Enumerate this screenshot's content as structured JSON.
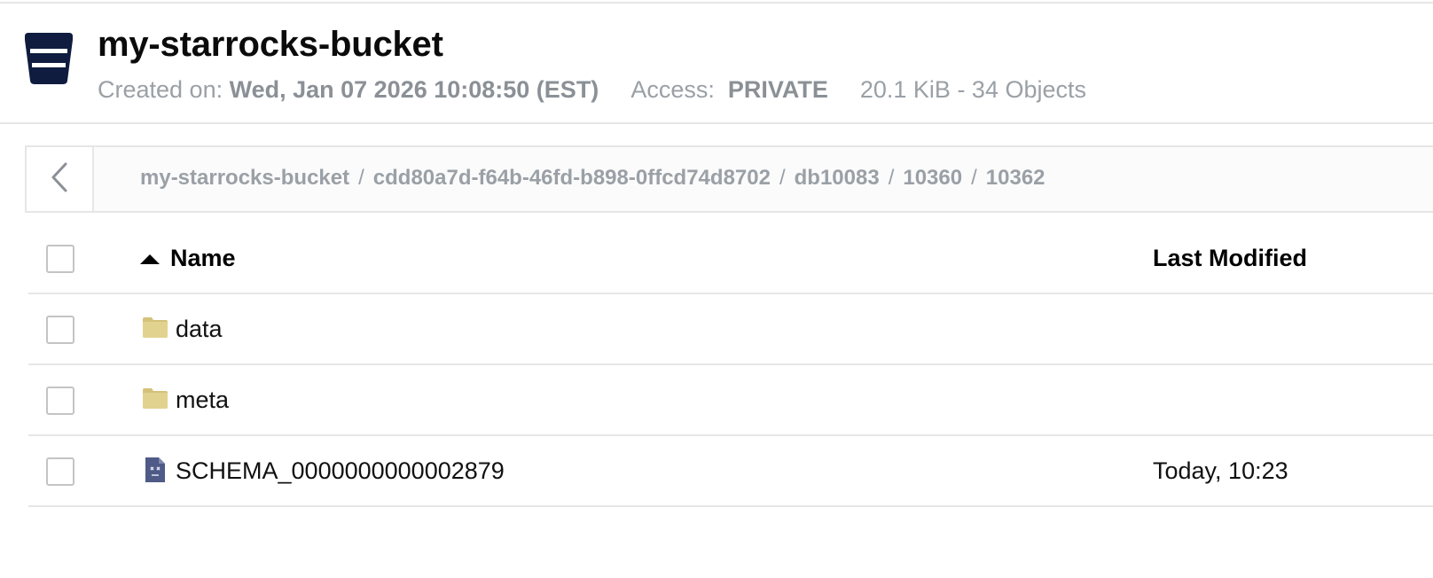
{
  "bucket": {
    "name": "my-starrocks-bucket",
    "created_label": "Created on: ",
    "created_value": "Wed, Jan 07 2026 10:08:50 (EST)",
    "access_label": "Access:",
    "access_value": "PRIVATE",
    "usage": "20.1 KiB - 34 Objects"
  },
  "breadcrumb": {
    "separator": "/",
    "items": [
      "my-starrocks-bucket",
      "cdd80a7d-f64b-46fd-b898-0ffcd74d8702",
      "db10083",
      "10360",
      "10362"
    ]
  },
  "table": {
    "columns": {
      "name": "Name",
      "last_modified": "Last Modified"
    },
    "sort": "ascending",
    "rows": [
      {
        "type": "folder",
        "name": "data",
        "last_modified": ""
      },
      {
        "type": "folder",
        "name": "meta",
        "last_modified": ""
      },
      {
        "type": "file",
        "name": "SCHEMA_0000000000002879",
        "last_modified": "Today, 10:23"
      }
    ]
  },
  "icons": {
    "bucket": "bucket-icon",
    "back": "chevron-left-icon",
    "sort": "sort-ascending-icon",
    "folder": "folder-icon",
    "file": "file-icon"
  },
  "colors": {
    "bucket_icon": "#0f1c3f",
    "folder": "#e2d28f",
    "file": "#4f5a86",
    "muted_text": "#9aa0a6",
    "border": "#e6e6e6"
  }
}
